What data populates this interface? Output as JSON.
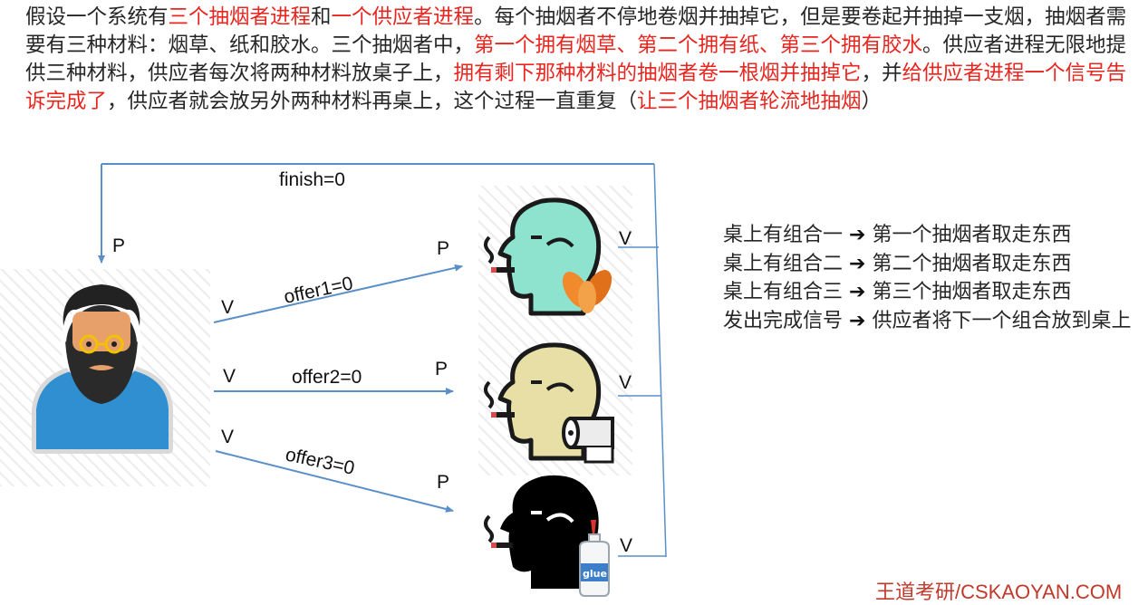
{
  "paragraph": {
    "s1": "假设一个系统有",
    "s2": "三个抽烟者进程",
    "s3": "和",
    "s4": "一个供应者进程",
    "s5": "。每个抽烟者不停地卷烟并抽掉它，但是要卷起并抽掉一支烟，抽烟者需要有三种材料：烟草、纸和胶水。三个抽烟者中，",
    "s6": "第一个拥有烟草、第二个拥有纸、第三个拥有胶水",
    "s7": "。供应者进程无限地提供三种材料，供应者每次将两种材料放桌子上，",
    "s8": "拥有剩下那种材料的抽烟者卷一根烟并抽掉它",
    "s9": "，并",
    "s10": "给供应者进程一个信号告诉完成了",
    "s11": "，供应者就会放另外两种材料再桌上，这个过程一直重复（",
    "s12": "让三个抽烟者轮流地抽烟",
    "s13": "）"
  },
  "diagram": {
    "finish_label": "finish=0",
    "offer1_label": "offer1=0",
    "offer2_label": "offer2=0",
    "offer3_label": "offer3=0",
    "p": "P",
    "v": "V",
    "glue_text": "glue"
  },
  "legend": {
    "line1_left": "桌上有组合一",
    "line1_right": "第一个抽烟者取走东西",
    "line2_left": "桌上有组合二",
    "line2_right": "第二个抽烟者取走东西",
    "line3_left": "桌上有组合三",
    "line3_right": "第三个抽烟者取走东西",
    "line4": "发出完成信号 ",
    "line4_right": "供应者将下一个组合放到桌上",
    "arrow": "➔"
  },
  "watermark": "王道考研/CSKAOYAN.COM",
  "colors": {
    "accent_red": "#e8261f",
    "arrow_blue": "#5b8fc9",
    "smoker1": "#8ee3cf",
    "smoker2": "#e7dfa6",
    "smoker3": "#000000",
    "supplier_shirt": "#2f8fd0"
  }
}
